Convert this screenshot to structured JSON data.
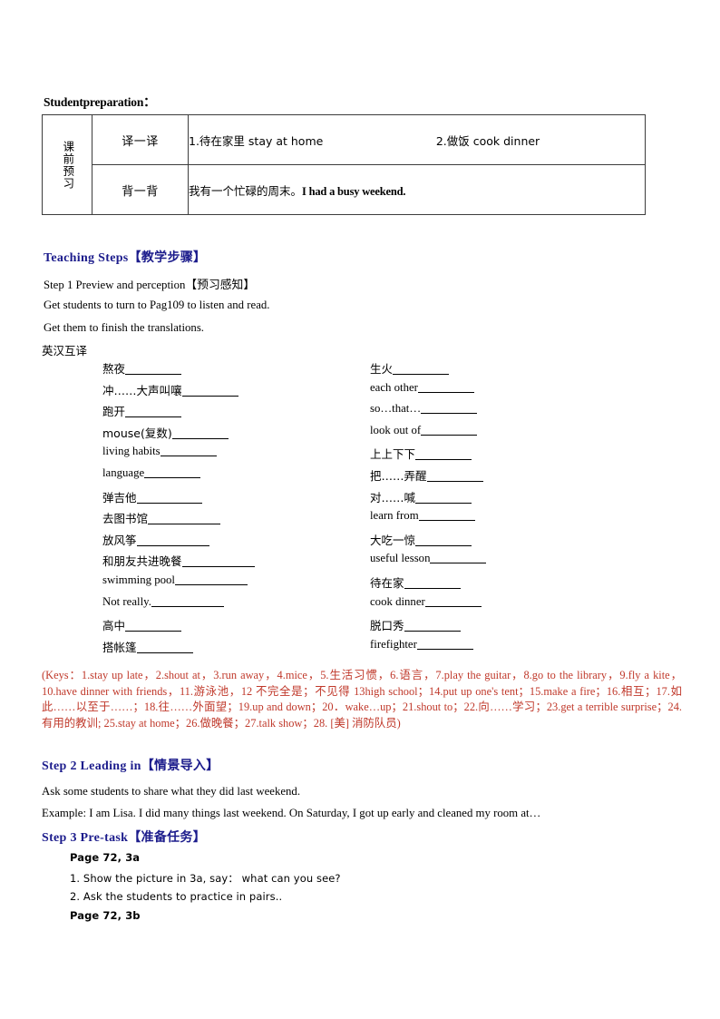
{
  "document": {
    "prep_title": "Studentpreparation：",
    "table": {
      "row_label": "课前预习",
      "rows": [
        {
          "kind": "译一译",
          "item1": "1.待在家里 stay at home",
          "item2": "2.做饭 cook dinner"
        },
        {
          "kind": "背一背",
          "cn": "我有一个忙碌的周末。",
          "en": "I had a busy weekend."
        }
      ]
    },
    "teaching_steps_heading": "Teaching  Steps【教学步骤】",
    "step1": {
      "heading": "Step 1    Preview and perception【预习感知】",
      "line1": "Get students to turn to Pag109 to listen and read.",
      "line2": "Get them to finish the translations.",
      "line3": "英汉互译"
    },
    "vocab": {
      "left": [
        {
          "text": "熬夜",
          "rule": 62
        },
        {
          "text": "冲……大声叫嚷",
          "rule": 62
        },
        {
          "text": "跑开",
          "rule": 62
        },
        {
          "text": "mouse(复数)",
          "rule": 62
        },
        {
          "text": "living habits",
          "rule": 62
        },
        {
          "text": "language",
          "rule": 62
        },
        {
          "text": "弹吉他",
          "rule": 72
        },
        {
          "text": "去图书馆",
          "rule": 80
        },
        {
          "text": "放风筝",
          "rule": 80
        },
        {
          "text": "和朋友共进晚餐",
          "rule": 80
        },
        {
          "text": "swimming pool",
          "rule": 80
        },
        {
          "text": "Not really.",
          "rule": 80
        },
        {
          "text": "高中",
          "rule": 62
        },
        {
          "text": "搭帐篷",
          "rule": 62
        }
      ],
      "right": [
        {
          "text": "生火",
          "rule": 62
        },
        {
          "text": "each other",
          "rule": 62
        },
        {
          "text": "so…that…",
          "rule": 62
        },
        {
          "text": "look out of",
          "rule": 62
        },
        {
          "text": "上上下下",
          "rule": 62
        },
        {
          "text": "把……弄醒",
          "rule": 62
        },
        {
          "text": "对……喊",
          "rule": 62
        },
        {
          "text": "learn from",
          "rule": 62
        },
        {
          "text": "大吃一惊",
          "rule": 62
        },
        {
          "text": "useful lesson",
          "rule": 62
        },
        {
          "text": "待在家",
          "rule": 62
        },
        {
          "text": "cook dinner",
          "rule": 62
        },
        {
          "text": "脱口秀",
          "rule": 62
        },
        {
          "text": "firefighter",
          "rule": 62
        }
      ]
    },
    "keys_paragraph": "(Keys：1.stay up late，2.shout at，3.run away，4.mice，5.生活习惯，6.语言，7.play the guitar，8.go to the library，9.fly a kite，10.have dinner with friends，11.游泳池，12 不完全是；不见得 13high school；14.put up one's tent；15.make a fire；16.相互；17.如此……以至于……；18.往……外面望；19.up and down；20．wake…up；21.shout to；22.向……学习；23.get a terrible surprise；24.有用的教训; 25.stay at home；26.做晚餐；27.talk show；28. [美] 消防队员)",
    "step2": {
      "heading": "Step 2   Leading in【情景导入】",
      "line1": "Ask some students to share what they did last weekend.",
      "line2": "Example: I am Lisa. I did many things last weekend. On Saturday, I got up early and cleaned my room at…"
    },
    "step3": {
      "heading": "Step 3    Pre-task【准备任务】",
      "lines": [
        "Page 72, 3a",
        "1. Show the picture in 3a, say：  what can you see?",
        "2. Ask the students to practice in pairs..",
        "Page 72, 3b"
      ]
    },
    "colors": {
      "heading_blue": "#1c1c8c",
      "keys_red": "#c0392b",
      "table_border": "#3c3c3c",
      "text_black": "#000000"
    }
  }
}
